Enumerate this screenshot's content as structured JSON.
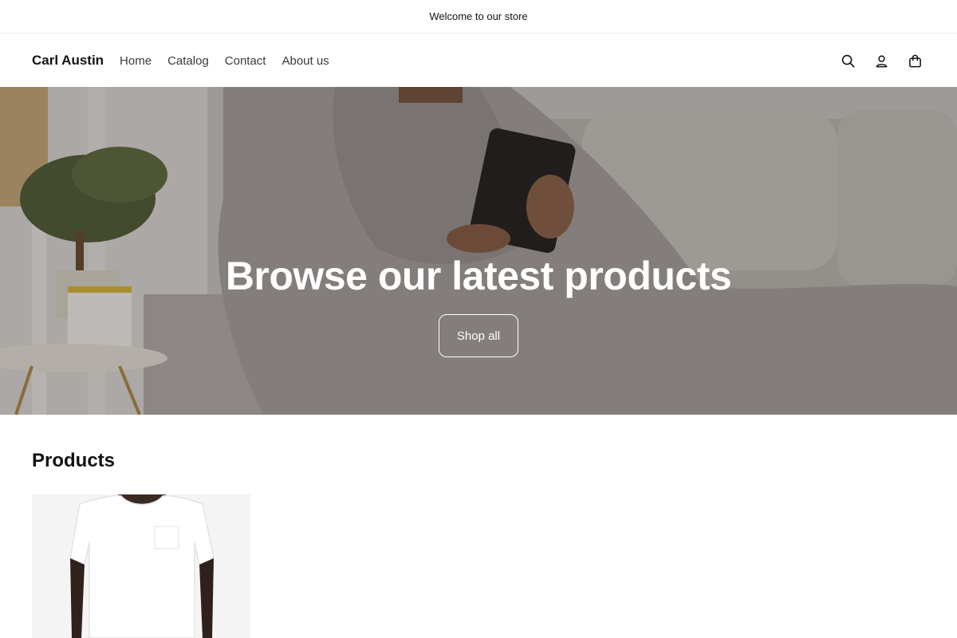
{
  "announcement": {
    "text": "Welcome to our store"
  },
  "header": {
    "brand": "Carl Austin",
    "nav": [
      {
        "label": "Home"
      },
      {
        "label": "Catalog"
      },
      {
        "label": "Contact"
      },
      {
        "label": "About us"
      }
    ],
    "icons": [
      "search-icon",
      "account-icon",
      "cart-icon"
    ]
  },
  "hero": {
    "title": "Browse our latest products",
    "button_label": "Shop all"
  },
  "products": {
    "heading": "Products"
  }
}
